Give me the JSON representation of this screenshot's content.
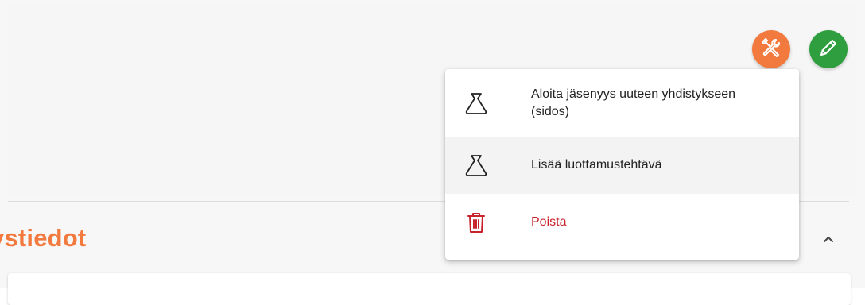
{
  "section": {
    "title": "ystiedot"
  },
  "toolbar": {
    "tools_icon": "tools-icon",
    "edit_icon": "pencil-icon"
  },
  "menu": {
    "items": [
      {
        "label": "Aloita jäsenyys uuteen yhdistykseen (sidos)",
        "icon": "bag-icon"
      },
      {
        "label": "Lisää luottamustehtävä",
        "icon": "bag-icon"
      },
      {
        "label": "Poista",
        "icon": "trash-icon"
      }
    ]
  },
  "colors": {
    "accent_orange": "#f37a3f",
    "edit_green": "#2e9e3e",
    "danger_red": "#c8232c"
  }
}
